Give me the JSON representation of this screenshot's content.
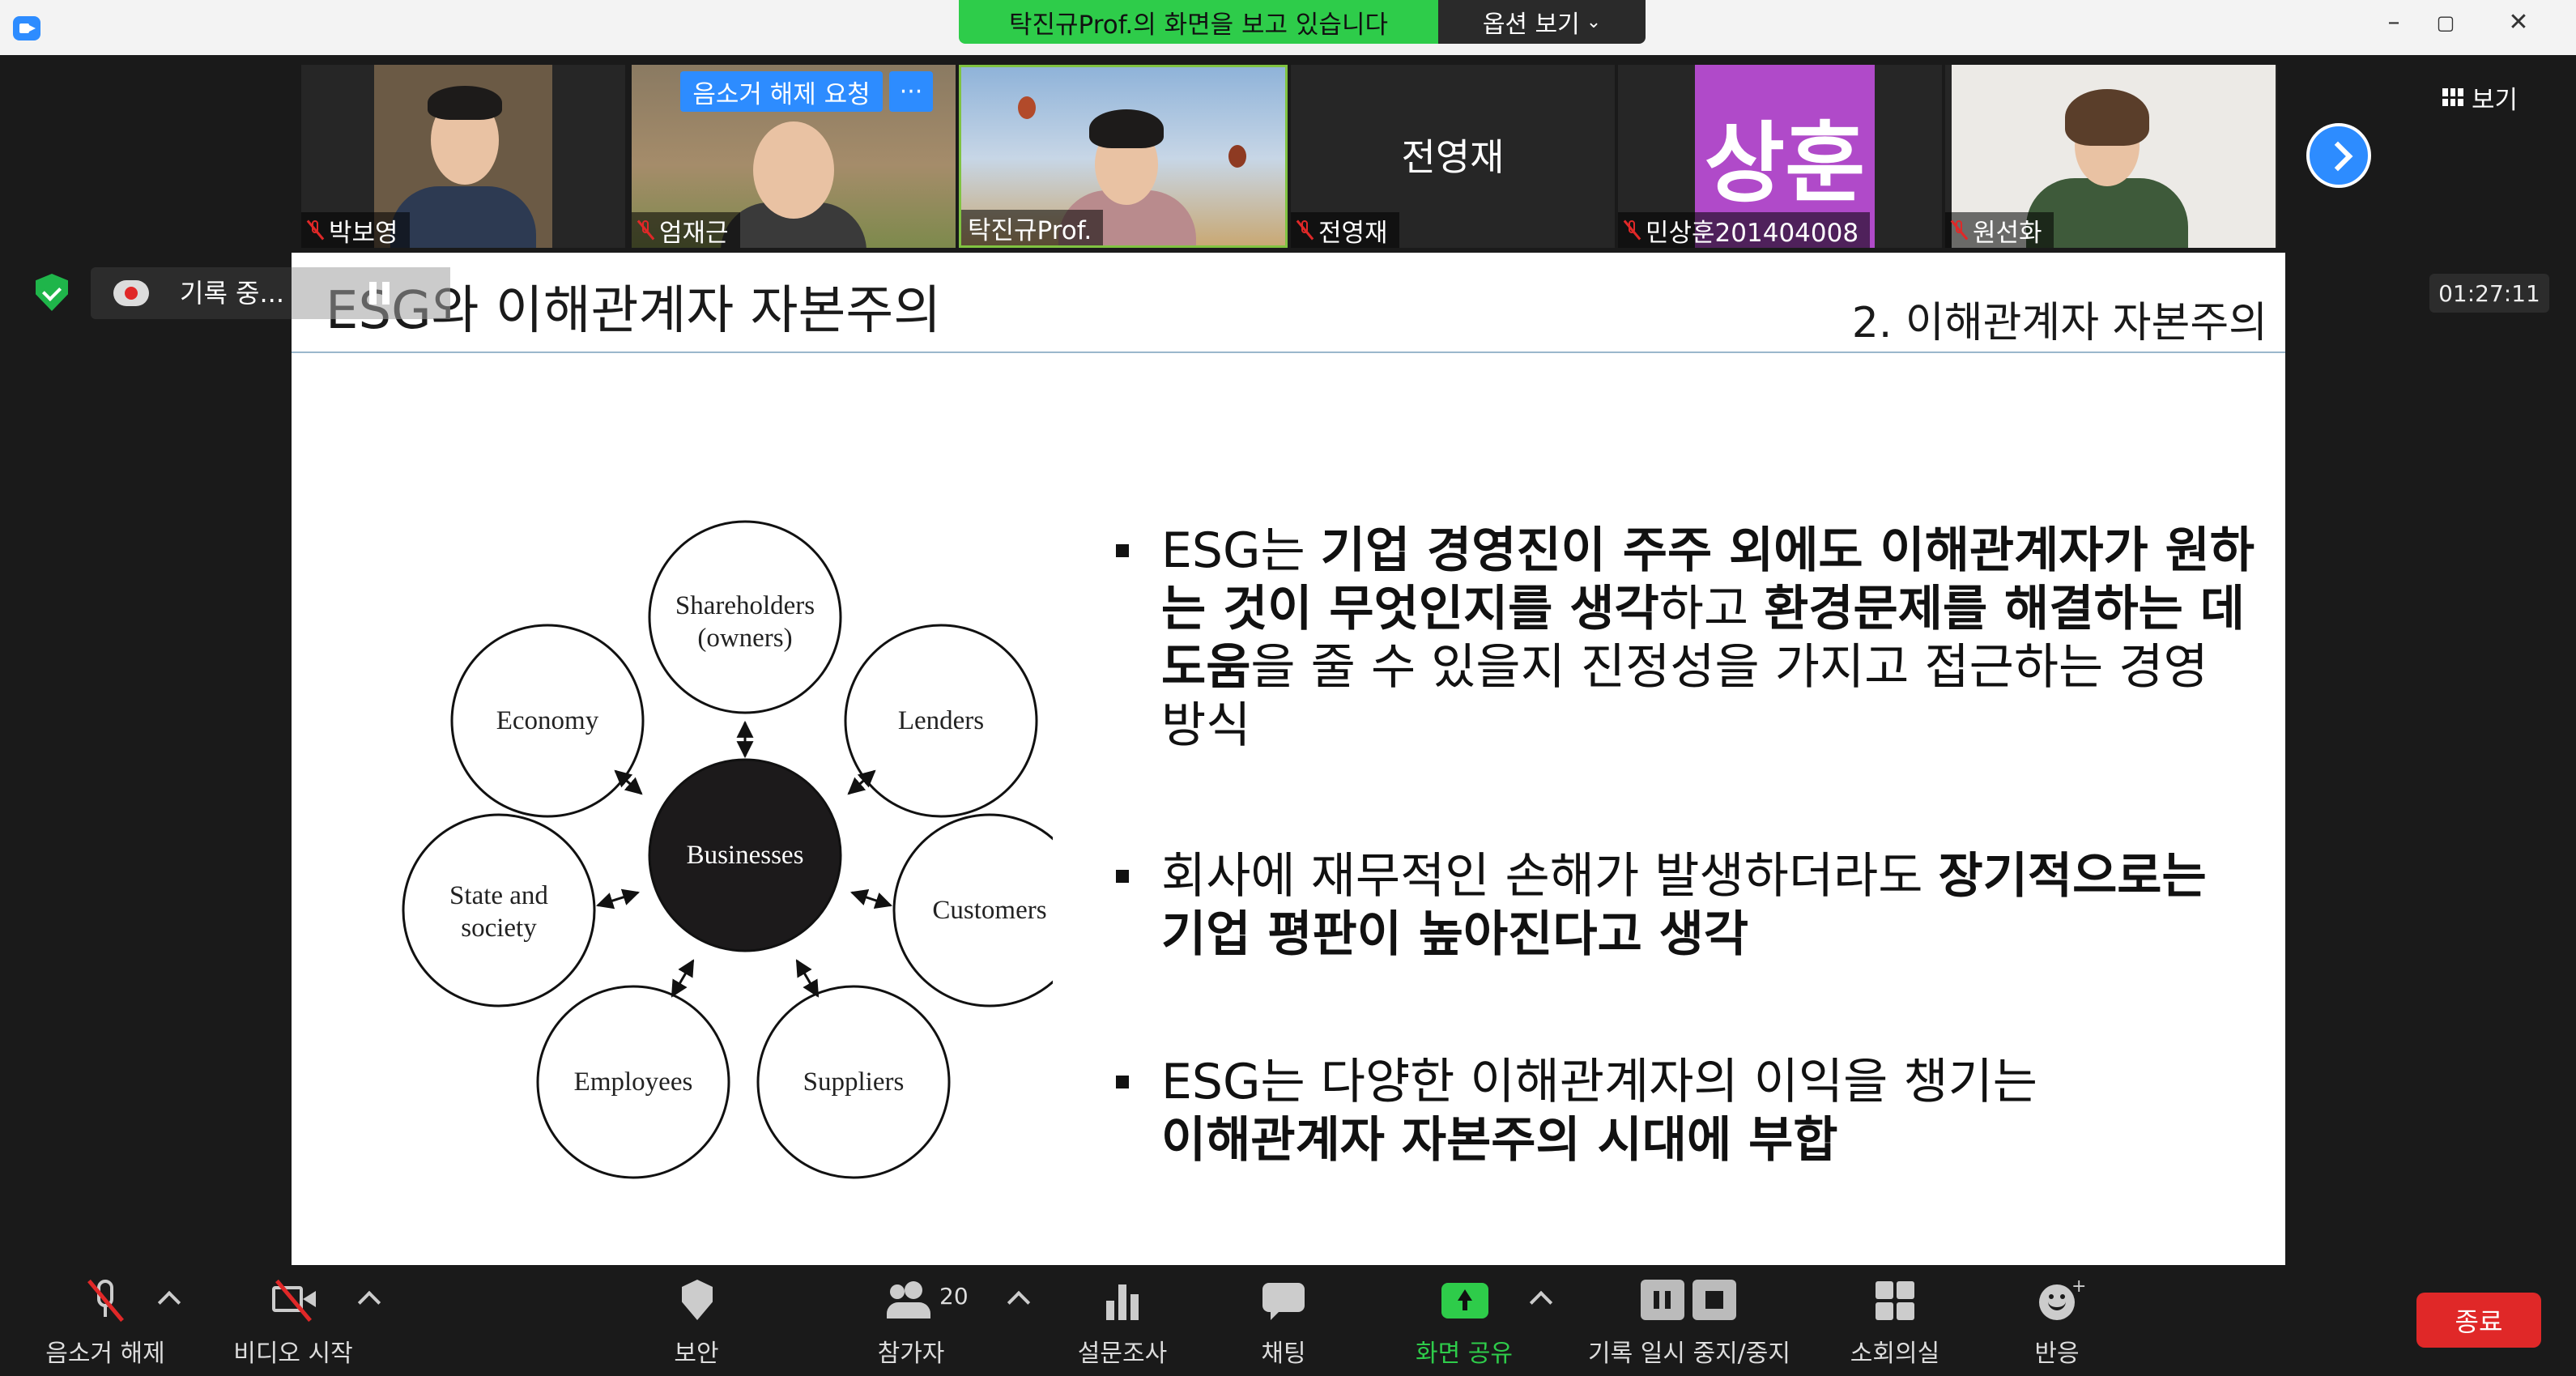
{
  "titlebar": {
    "share_banner": "탁진규Prof.의 화면을 보고 있습니다",
    "view_options": "옵션 보기",
    "minimize": "–",
    "maximize": "▢",
    "close": "✕"
  },
  "participants": [
    {
      "name": "박보영",
      "muted": true
    },
    {
      "name": "엄재근",
      "muted": true,
      "unmute_request": "음소거 해제 요청",
      "more": "···"
    },
    {
      "name": "탁진규Prof.",
      "muted": false,
      "active_speaker": true
    },
    {
      "name": "전영재",
      "muted": true,
      "placeholder_name": "전영재"
    },
    {
      "name": "민상훈201404008",
      "muted": true,
      "avatar_text": "상훈"
    },
    {
      "name": "원선화",
      "muted": true
    }
  ],
  "view_button": "보기",
  "status": {
    "recording_label": "기록 중...",
    "timer": "01:27:11"
  },
  "slide": {
    "title": "ESG와 이해관계자 자본주의",
    "section": "2. 이해관계자 자본주의",
    "diagram": {
      "center": "Businesses",
      "nodes": [
        "Shareholders",
        "(owners)",
        "Lenders",
        "Customers",
        "Suppliers",
        "Employees",
        "State and",
        "society",
        "Economy"
      ]
    },
    "bullets": [
      {
        "parts": [
          {
            "text": "ESG는 ",
            "bold": false
          },
          {
            "text": "기업 경영진이 주주 외에도 이해관계자가 원하는 것이 무엇인지를 생각",
            "bold": true
          },
          {
            "text": "하고 ",
            "bold": false
          },
          {
            "text": "환경문제를 해결하는 데 도움",
            "bold": true
          },
          {
            "text": "을 줄 수 있을지 진정성을 가지고 접근하는 경영 방식",
            "bold": false
          }
        ]
      },
      {
        "parts": [
          {
            "text": "회사에 재무적인 손해가 발생하더라도 ",
            "bold": false
          },
          {
            "text": "장기적으로는 기업 평판이 높아진다고 생각",
            "bold": true
          }
        ]
      },
      {
        "parts": [
          {
            "text": "ESG는 다양한 이해관계자의 이익을 챙기는 ",
            "bold": false
          },
          {
            "text": "이해관계자 자본주의 시대에 부합",
            "bold": true
          }
        ]
      }
    ]
  },
  "toolbar": {
    "unmute": "음소거 해제",
    "start_video": "비디오 시작",
    "security": "보안",
    "participants": "참가자",
    "participant_count": "20",
    "polls": "설문조사",
    "chat": "채팅",
    "share_screen": "화면 공유",
    "recording_controls": "기록 일시 중지/중지",
    "breakout": "소회의실",
    "reactions": "반응",
    "end": "종료"
  },
  "colors": {
    "share_green": "#2ecc4a",
    "zoom_blue": "#2d8cff",
    "end_red": "#e02828",
    "avatar_purple": "#b04ac9"
  }
}
